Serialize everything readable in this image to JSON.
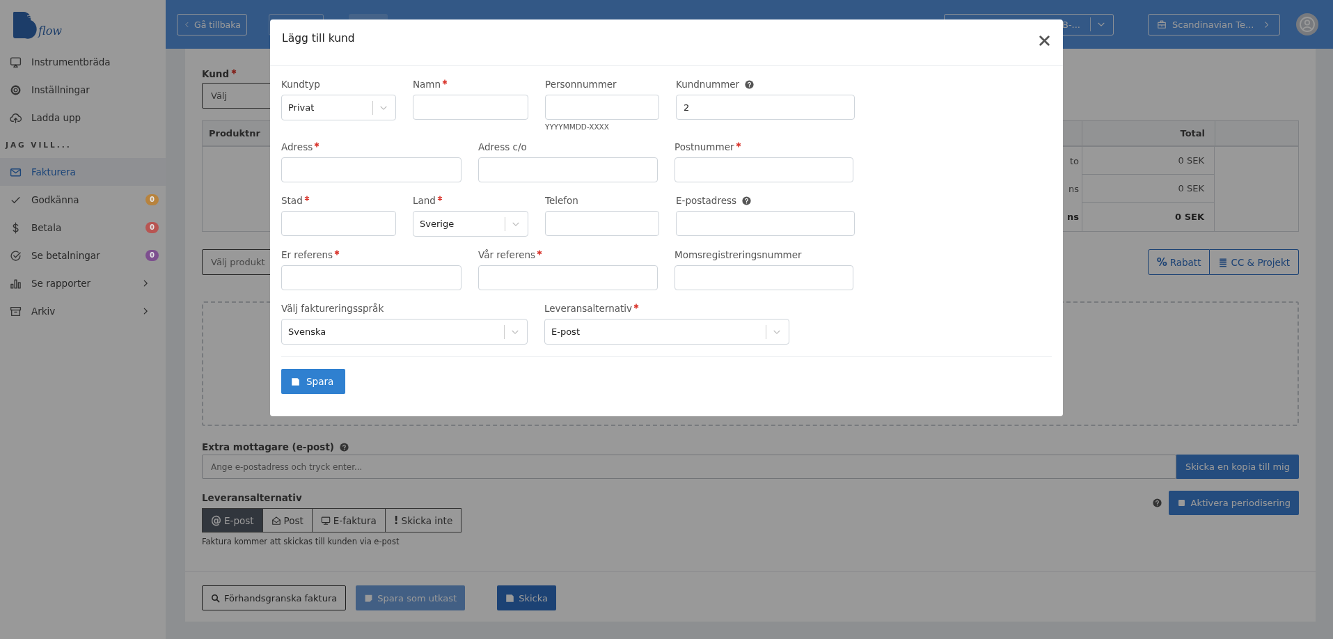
{
  "sidebar": {
    "logo_text": "flow",
    "nav": [
      {
        "label": "Instrumentbräda",
        "kind": "link",
        "selected": false
      },
      {
        "label": "Inställningar",
        "kind": "link",
        "selected": false
      },
      {
        "label": "Ladda upp",
        "kind": "link",
        "selected": false
      }
    ],
    "section_title": "JAG VILL...",
    "section_nav": [
      {
        "label": "Fakturera",
        "kind": "link",
        "selected": true
      },
      {
        "label": "Godkänna",
        "kind": "link",
        "selected": false,
        "badge": {
          "text": "0",
          "color": "#b7833e"
        }
      },
      {
        "label": "Betala",
        "kind": "link",
        "selected": false,
        "badge": {
          "text": "0",
          "color": "#b85552"
        }
      },
      {
        "label": "Se betalningar",
        "kind": "link",
        "selected": false,
        "badge": {
          "text": "0",
          "color": "#7d4f8f"
        }
      },
      {
        "label": "Se rapporter",
        "kind": "submenu",
        "selected": false
      },
      {
        "label": "Arkiv",
        "kind": "submenu",
        "selected": false
      }
    ]
  },
  "topbar": {
    "back_button": "Gå tillbaka",
    "account_select": "B-...",
    "company_button": "Scandinavian Te..."
  },
  "invoice": {
    "customer": {
      "label": "Kund",
      "required": true,
      "placeholder": "Välj"
    },
    "table": {
      "columns": [
        "Produktnr",
        "Total"
      ],
      "summary_rows": [
        {
          "label": "to",
          "total": "0 SEK",
          "bold": false
        },
        {
          "label": "ns",
          "total": "0 SEK",
          "bold": false
        },
        {
          "label": "ns",
          "total": "0 SEK",
          "bold": true
        }
      ]
    },
    "product_placeholder": "Välj produkt",
    "tool_buttons": [
      {
        "icon_text": "%",
        "label": "Rabatt"
      },
      {
        "label": "CC & Projekt"
      }
    ],
    "extra_recipients": {
      "label": "Extra mottagare (e-post)",
      "help": true,
      "placeholder": "Ange e-postadress och tryck enter...",
      "button": "Skicka en kopia till mig"
    },
    "delivery": {
      "label": "Leveransalternativ",
      "options": [
        {
          "icon_text": "@",
          "label": "E-post",
          "selected": true
        },
        {
          "label": "Post",
          "selected": false
        },
        {
          "label": "E-faktura",
          "selected": false
        },
        {
          "icon_text": "!",
          "label": "Skicka inte",
          "selected": false
        }
      ],
      "note": "Faktura kommer att skickas till kunden via e-post"
    },
    "periodize": {
      "label": "Aktivera periodisering",
      "checked": false,
      "help": true
    },
    "footer_buttons": [
      {
        "label": "Förhandsgranska faktura",
        "kind": "outline",
        "disabled": false
      },
      {
        "label": "Spara som utkast",
        "kind": "draft",
        "disabled": true
      },
      {
        "label": "Skicka",
        "kind": "primary",
        "disabled": false
      }
    ]
  },
  "modal": {
    "title": "Lägg till kund",
    "rows": [
      [
        {
          "label": "Kundtyp",
          "kind": "select",
          "value": "Privat",
          "required": false,
          "help": false
        },
        {
          "label": "Namn",
          "kind": "text",
          "required": true,
          "help": false
        },
        {
          "label": "Personnummer",
          "kind": "text",
          "required": false,
          "help": false,
          "hint": "YYYYMMDD-XXXX"
        },
        {
          "label": "Kundnummer",
          "kind": "text",
          "value": "2",
          "required": false,
          "help": true
        }
      ],
      [
        {
          "label": "Adress",
          "kind": "text",
          "required": true,
          "help": false
        },
        {
          "label": "Adress c/o",
          "kind": "text",
          "required": false,
          "help": false
        },
        {
          "label": "Postnummer",
          "kind": "text",
          "required": true,
          "help": false
        }
      ],
      [
        {
          "label": "Stad",
          "kind": "text",
          "required": true,
          "help": false
        },
        {
          "label": "Land",
          "kind": "select",
          "value": "Sverige",
          "required": true,
          "help": false
        },
        {
          "label": "Telefon",
          "kind": "text",
          "required": false,
          "help": false
        },
        {
          "label": "E-postadress",
          "kind": "text",
          "required": false,
          "help": true
        }
      ],
      [
        {
          "label": "Er referens",
          "kind": "text",
          "required": true,
          "help": false
        },
        {
          "label": "Vår referens",
          "kind": "text",
          "required": true,
          "help": false
        },
        {
          "label": "Momsregistreringsnummer",
          "kind": "text",
          "required": false,
          "help": false
        }
      ],
      [
        {
          "label": "Välj faktureringsspråk",
          "kind": "select",
          "value": "Svenska",
          "required": false,
          "help": false
        },
        {
          "label": "Leveransalternativ",
          "kind": "select",
          "value": "E-post",
          "required": true,
          "help": false
        }
      ]
    ],
    "save_button": "Spara"
  }
}
